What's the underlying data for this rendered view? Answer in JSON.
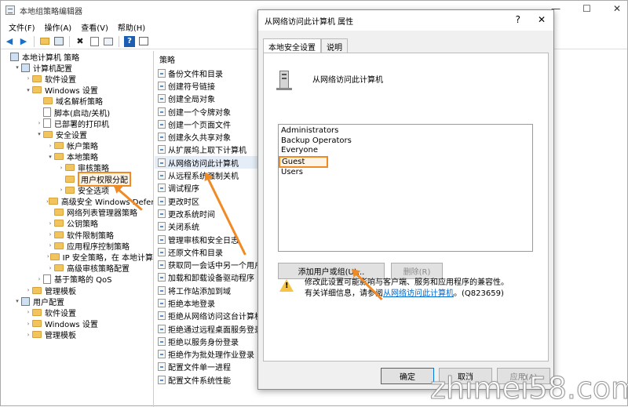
{
  "window": {
    "title": "本地组策略编辑器",
    "controls": [
      "—",
      "☐",
      "✕"
    ]
  },
  "menubar": {
    "items": [
      "文件(F)",
      "操作(A)",
      "查看(V)",
      "帮助(H)"
    ]
  },
  "toolbar": {
    "icons": [
      "back-icon",
      "forward-icon",
      "folder-up-icon",
      "properties-icon",
      "delete-icon",
      "export-icon",
      "refresh-icon",
      "help-icon",
      "view-icon"
    ]
  },
  "tree": {
    "items": [
      {
        "label": "本地计算机 策略",
        "indent": 0,
        "toggle": "",
        "icon": "policy"
      },
      {
        "label": "计算机配置",
        "indent": 1,
        "toggle": "▾",
        "icon": "pc"
      },
      {
        "label": "软件设置",
        "indent": 2,
        "toggle": "›",
        "icon": "folder"
      },
      {
        "label": "Windows 设置",
        "indent": 2,
        "toggle": "▾",
        "icon": "folder"
      },
      {
        "label": "域名解析策略",
        "indent": 3,
        "toggle": "",
        "icon": "folder"
      },
      {
        "label": "脚本(启动/关机)",
        "indent": 3,
        "toggle": "",
        "icon": "doc"
      },
      {
        "label": "已部署的打印机",
        "indent": 3,
        "toggle": "›",
        "icon": "doc"
      },
      {
        "label": "安全设置",
        "indent": 3,
        "toggle": "▾",
        "icon": "folder"
      },
      {
        "label": "帐户策略",
        "indent": 4,
        "toggle": "›",
        "icon": "folder"
      },
      {
        "label": "本地策略",
        "indent": 4,
        "toggle": "▾",
        "icon": "folder"
      },
      {
        "label": "审核策略",
        "indent": 5,
        "toggle": "›",
        "icon": "folder"
      },
      {
        "label": "用户权限分配",
        "indent": 5,
        "toggle": "",
        "icon": "folder",
        "highlighted": true
      },
      {
        "label": "安全选项",
        "indent": 5,
        "toggle": "›",
        "icon": "folder"
      },
      {
        "label": "高级安全 Windows Defend",
        "indent": 4,
        "toggle": "›",
        "icon": "folder"
      },
      {
        "label": "网络列表管理器策略",
        "indent": 4,
        "toggle": "",
        "icon": "folder"
      },
      {
        "label": "公钥策略",
        "indent": 4,
        "toggle": "›",
        "icon": "folder"
      },
      {
        "label": "软件限制策略",
        "indent": 4,
        "toggle": "›",
        "icon": "folder"
      },
      {
        "label": "应用程序控制策略",
        "indent": 4,
        "toggle": "›",
        "icon": "folder"
      },
      {
        "label": "IP 安全策略，在 本地计算",
        "indent": 4,
        "toggle": "›",
        "icon": "folder"
      },
      {
        "label": "高级审核策略配置",
        "indent": 4,
        "toggle": "›",
        "icon": "folder"
      },
      {
        "label": "基于策略的 QoS",
        "indent": 3,
        "toggle": "›",
        "icon": "doc"
      },
      {
        "label": "管理模板",
        "indent": 2,
        "toggle": "›",
        "icon": "folder"
      },
      {
        "label": "用户配置",
        "indent": 1,
        "toggle": "▾",
        "icon": "pc"
      },
      {
        "label": "软件设置",
        "indent": 2,
        "toggle": "›",
        "icon": "folder"
      },
      {
        "label": "Windows 设置",
        "indent": 2,
        "toggle": "›",
        "icon": "folder"
      },
      {
        "label": "管理模板",
        "indent": 2,
        "toggle": "›",
        "icon": "folder"
      }
    ]
  },
  "policy_list": {
    "header": "策略",
    "items": [
      "备份文件和目录",
      "创建符号链接",
      "创建全局对象",
      "创建一个令牌对象",
      "创建一个页面文件",
      "创建永久共享对象",
      "从扩展坞上取下计算机",
      "从网络访问此计算机",
      "从远程系统强制关机",
      "调试程序",
      "更改时区",
      "更改系统时间",
      "关闭系统",
      "管理审核和安全日志",
      "还原文件和目录",
      "获取同一会话中另一个用户",
      "加载和卸载设备驱动程序",
      "将工作站添加到域",
      "拒绝本地登录",
      "拒绝从网络访问这台计算机",
      "拒绝通过远程桌面服务登录",
      "拒绝以服务身份登录",
      "拒绝作为批处理作业登录",
      "配置文件单一进程",
      "配置文件系统性能"
    ],
    "selected_index": 7
  },
  "dialog": {
    "title": "从网络访问此计算机 属性",
    "help": "?",
    "close": "✕",
    "tabs": [
      "本地安全设置",
      "说明"
    ],
    "policy_name": "从网络访问此计算机",
    "users": [
      "Administrators",
      "Backup Operators",
      "Everyone",
      "Guest",
      "Users"
    ],
    "highlighted_user": "Guest",
    "add_button": "添加用户或组(U)...",
    "remove_button": "删除(R)",
    "warning_line1": "修改此设置可能影响与客户端、服务和应用程序的兼容性。",
    "warning_line2_prefix": "有关详细信息，请参阅",
    "warning_link": "从网络访问此计算机",
    "warning_suffix": "。(Q823659)",
    "ok_button": "确定",
    "cancel_button": "取消",
    "apply_button": "应用(A)"
  },
  "watermark": "zhimei58.com",
  "colors": {
    "highlight": "#f08a24",
    "link": "#0066cc",
    "selection": "#e5eef8"
  }
}
